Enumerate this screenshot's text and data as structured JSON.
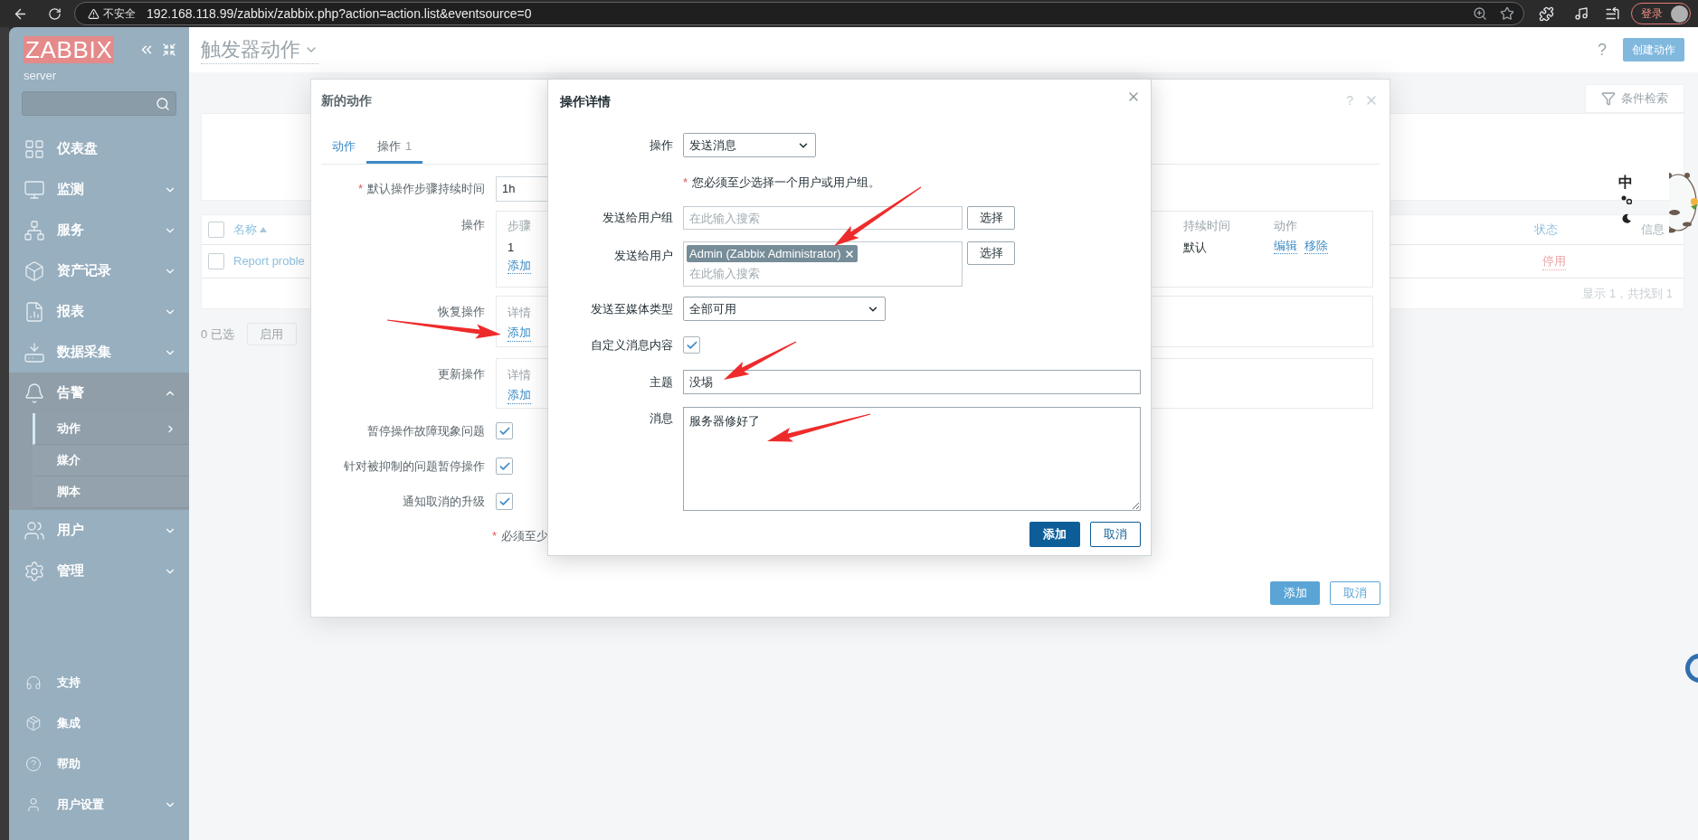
{
  "browser": {
    "security": "不安全",
    "url": "192.168.118.99/zabbix/zabbix.php?action=action.list&eventsource=0",
    "login": "登录"
  },
  "sidebar": {
    "logo": "ZABBIX",
    "server": "server",
    "menu": [
      {
        "label": "仪表盘"
      },
      {
        "label": "监测",
        "expanded": false
      },
      {
        "label": "服务",
        "expanded": false
      },
      {
        "label": "资产记录",
        "expanded": false
      },
      {
        "label": "报表",
        "expanded": false
      },
      {
        "label": "数据采集",
        "expanded": false
      },
      {
        "label": "告警",
        "expanded": true,
        "children": [
          {
            "label": "动作",
            "selected": true
          },
          {
            "label": "媒介",
            "selected": false
          },
          {
            "label": "脚本",
            "selected": false
          }
        ]
      },
      {
        "label": "用户",
        "expanded": false
      },
      {
        "label": "管理",
        "expanded": false
      }
    ],
    "bottom": [
      {
        "label": "支持"
      },
      {
        "label": "集成"
      },
      {
        "label": "帮助"
      },
      {
        "label": "用户设置",
        "expanded": false
      }
    ]
  },
  "page": {
    "title": "触发器动作",
    "help": "?",
    "create_button": "创建动作",
    "filter_tab": "条件检索",
    "table": {
      "select_all": false,
      "columns": [
        "名称",
        "状态",
        "信息"
      ],
      "rows": [
        {
          "checked": false,
          "name": "Report proble",
          "status": "停用"
        }
      ],
      "footer": "显示 1，共找到 1"
    },
    "selected_count": "0 已选",
    "enable_button": "启用"
  },
  "action_modal": {
    "title": "新的动作",
    "help": "?",
    "tabs": [
      {
        "label": "动作",
        "selected": false
      },
      {
        "label": "操作",
        "count": "1",
        "selected": true
      }
    ],
    "duration": {
      "mark": "*",
      "label": "默认操作步骤持续时间",
      "value": "1h"
    },
    "operations": {
      "label": "操作",
      "columns": [
        "步骤",
        "持续时间",
        "动作"
      ],
      "rows": [
        {
          "step": "1",
          "duration": "默认",
          "actions": [
            "编辑",
            "移除"
          ]
        }
      ],
      "add": "添加"
    },
    "recovery": {
      "label": "恢复操作",
      "column": "详情",
      "add": "添加"
    },
    "update": {
      "label": "更新操作",
      "column": "详情",
      "add": "添加"
    },
    "checkboxes": [
      {
        "label": "暂停操作故障现象问题",
        "checked": true
      },
      {
        "label": "针对被抑制的问题暂停操作",
        "checked": true
      },
      {
        "label": "通知取消的升级",
        "checked": true
      }
    ],
    "note_mark": "*",
    "note": "必须至少",
    "add_button": "添加",
    "cancel_button": "取消"
  },
  "operation_dialog": {
    "title": "操作详情",
    "fields": [
      {
        "kind": "select",
        "label": "操作",
        "value": "发送消息"
      },
      {
        "kind": "note",
        "mark": "*",
        "text": "您必须至少选择一个用户或用户组。"
      },
      {
        "kind": "search",
        "label": "发送给用户组",
        "placeholder": "在此输入搜索",
        "button": "选择"
      },
      {
        "kind": "multiselect",
        "label": "发送给用户",
        "tags": [
          "Admin (Zabbix Administrator)"
        ],
        "placeholder": "在此输入搜索",
        "button": "选择"
      },
      {
        "kind": "select",
        "label": "发送至媒体类型",
        "value": "全部可用"
      },
      {
        "kind": "checkbox",
        "label": "自定义消息内容",
        "checked": true
      },
      {
        "kind": "input",
        "label": "主题",
        "value": "没埸"
      },
      {
        "kind": "textarea",
        "label": "消息",
        "value": "服务器修好了"
      }
    ],
    "add_button": "添加",
    "cancel_button": "取消"
  },
  "ime": "中"
}
